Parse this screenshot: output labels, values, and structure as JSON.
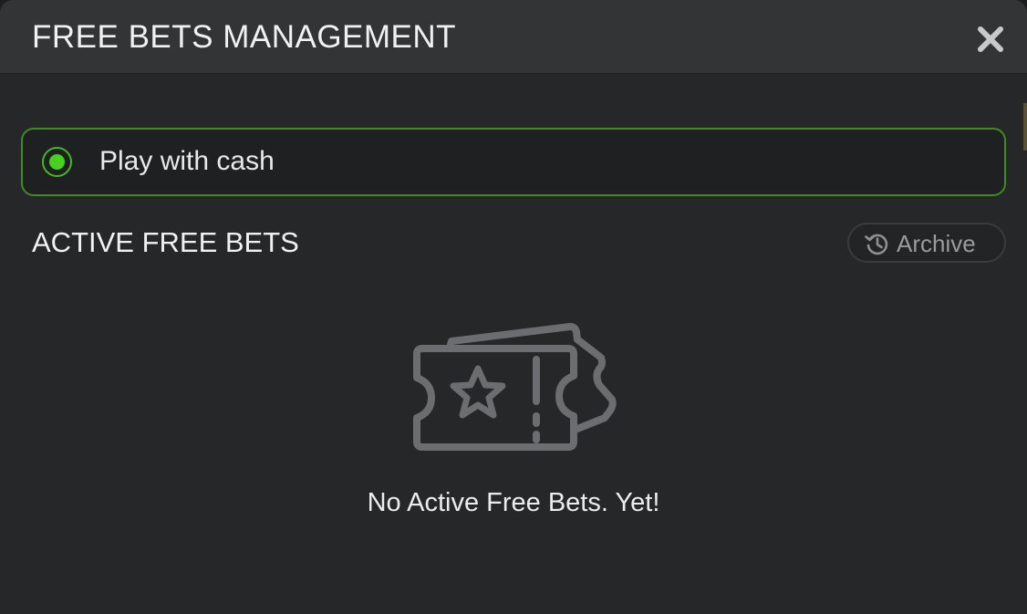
{
  "modal": {
    "title": "FREE BETS MANAGEMENT",
    "close_icon": "close-icon"
  },
  "cash_option": {
    "label": "Play with cash",
    "selected": true,
    "accent_color": "#46d11a"
  },
  "active_section": {
    "title": "ACTIVE FREE BETS",
    "archive_label": "Archive",
    "archive_icon": "history-icon"
  },
  "empty_state": {
    "icon": "ticket-star-icon",
    "message": "No Active Free Bets. Yet!"
  }
}
